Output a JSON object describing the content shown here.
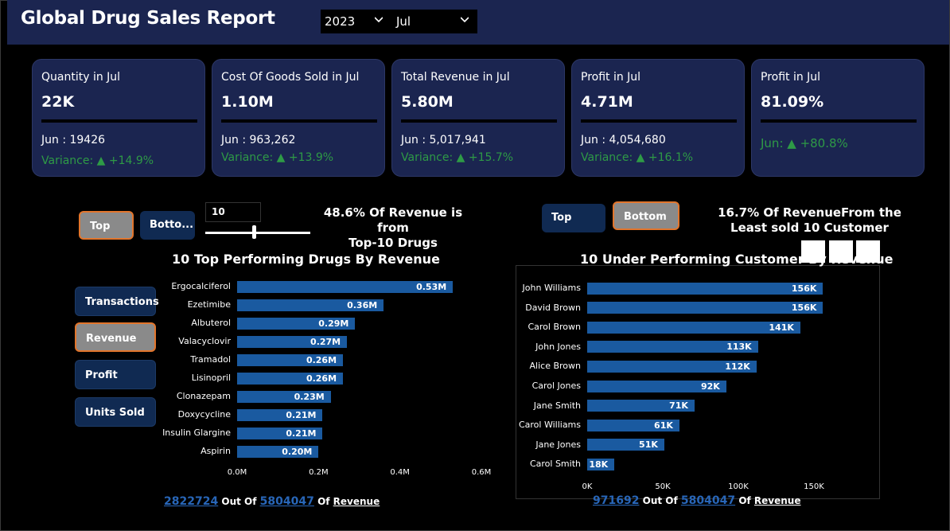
{
  "header": {
    "title": "Global Drug Sales Report",
    "year": "2023",
    "month": "Jul"
  },
  "cards": [
    {
      "label": "Quantity in Jul",
      "value": "22K",
      "prev": "Jun : 19426",
      "variance": "Variance: ▲ +14.9%"
    },
    {
      "label": "Cost Of Goods Sold in Jul",
      "value": "1.10M",
      "prev": "Jun : 963,262",
      "variance": "Variance: ▲ +13.9%"
    },
    {
      "label": "Total Revenue in Jul",
      "value": "5.80M",
      "prev": "Jun : 5,017,941",
      "variance": "Variance: ▲ +15.7%"
    },
    {
      "label": "Profit in Jul",
      "value": "4.71M",
      "prev": "Jun : 4,054,680",
      "variance": "Variance: ▲ +16.1%"
    },
    {
      "label": "Profit in Jul",
      "value": "81.09%",
      "variance": "Jun: ▲ +80.8%"
    }
  ],
  "left": {
    "toggle_top": "Top",
    "toggle_bottom": "Botto...",
    "n_value": "10",
    "callout_line1": "48.6% Of Revenue is from",
    "callout_line2": "Top-10 Drugs",
    "chart_title": "10 Top Performing Drugs By Revenue",
    "footer_value": "2822724",
    "footer_outof": "Out Of",
    "footer_total": "5804047",
    "footer_of": "Of",
    "footer_metric": "Revenue"
  },
  "metric_buttons": [
    "Transactions",
    "Revenue",
    "Profit",
    "Units Sold"
  ],
  "right": {
    "toggle_top": "Top",
    "toggle_bottom": "Bottom",
    "callout_line1": "16.7% Of RevenueFrom the",
    "callout_line2": "Least sold 10 Customer",
    "chart_title": "10 Under Performing Customer By Revenue",
    "footer_value": "971692",
    "footer_outof": "Out Of",
    "footer_total": "5804047",
    "footer_of": "Of",
    "footer_metric": "Revenue"
  },
  "colors": {
    "header_bg": "#1b2550",
    "card_bg": "#1b2550",
    "bar": "#1a5aa0",
    "variance_green": "#2e9a46",
    "active_border": "#e2752c"
  },
  "chart_data": [
    {
      "type": "bar",
      "orientation": "horizontal",
      "title": "10 Top Performing Drugs By Revenue",
      "categories": [
        "Ergocalciferol",
        "Ezetimibe",
        "Albuterol",
        "Valacyclovir",
        "Tramadol",
        "Lisinopril",
        "Clonazepam",
        "Doxycycline",
        "Insulin Glargine",
        "Aspirin"
      ],
      "values": [
        0.53,
        0.36,
        0.29,
        0.27,
        0.26,
        0.26,
        0.23,
        0.21,
        0.21,
        0.2
      ],
      "data_labels": [
        "0.53M",
        "0.36M",
        "0.29M",
        "0.27M",
        "0.26M",
        "0.26M",
        "0.23M",
        "0.21M",
        "0.21M",
        "0.20M"
      ],
      "xlim": [
        0,
        0.6
      ],
      "x_ticks": [
        "0.0M",
        "0.2M",
        "0.4M",
        "0.6M"
      ],
      "x_tick_values": [
        0,
        0.2,
        0.4,
        0.6
      ]
    },
    {
      "type": "bar",
      "orientation": "horizontal",
      "title": "10 Under Performing Customer By Revenue",
      "categories": [
        "John Williams",
        "David Brown",
        "Carol Brown",
        "John Jones",
        "Alice Brown",
        "Carol Jones",
        "Jane Smith",
        "Carol Williams",
        "Jane Jones",
        "Carol Smith"
      ],
      "values": [
        156,
        156,
        141,
        113,
        112,
        92,
        71,
        61,
        51,
        18
      ],
      "data_labels": [
        "156K",
        "156K",
        "141K",
        "113K",
        "112K",
        "92K",
        "71K",
        "61K",
        "51K",
        "18K"
      ],
      "xlim": [
        0,
        160
      ],
      "x_ticks": [
        "0K",
        "50K",
        "100K",
        "150K"
      ],
      "x_tick_values": [
        0,
        50,
        100,
        150
      ]
    }
  ]
}
